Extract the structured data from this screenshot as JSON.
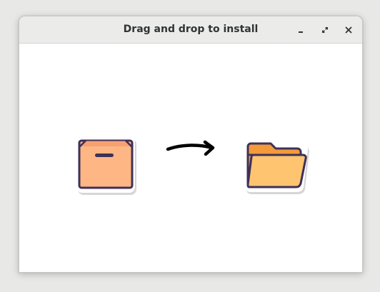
{
  "window": {
    "title": "Drag and drop to install",
    "controls": {
      "minimize": "minimize-icon",
      "maximize": "maximize-icon",
      "close": "close-icon"
    }
  },
  "content": {
    "source_icon": "package-box-icon",
    "arrow_icon": "arrow-right-icon",
    "target_icon": "folder-icon"
  },
  "colors": {
    "titlebar": "#ebebea",
    "box_fill": "#ffb685",
    "box_top": "#f7a070",
    "outline": "#3d3158",
    "folder_back": "#f49a3a",
    "folder_front": "#ffc470"
  }
}
